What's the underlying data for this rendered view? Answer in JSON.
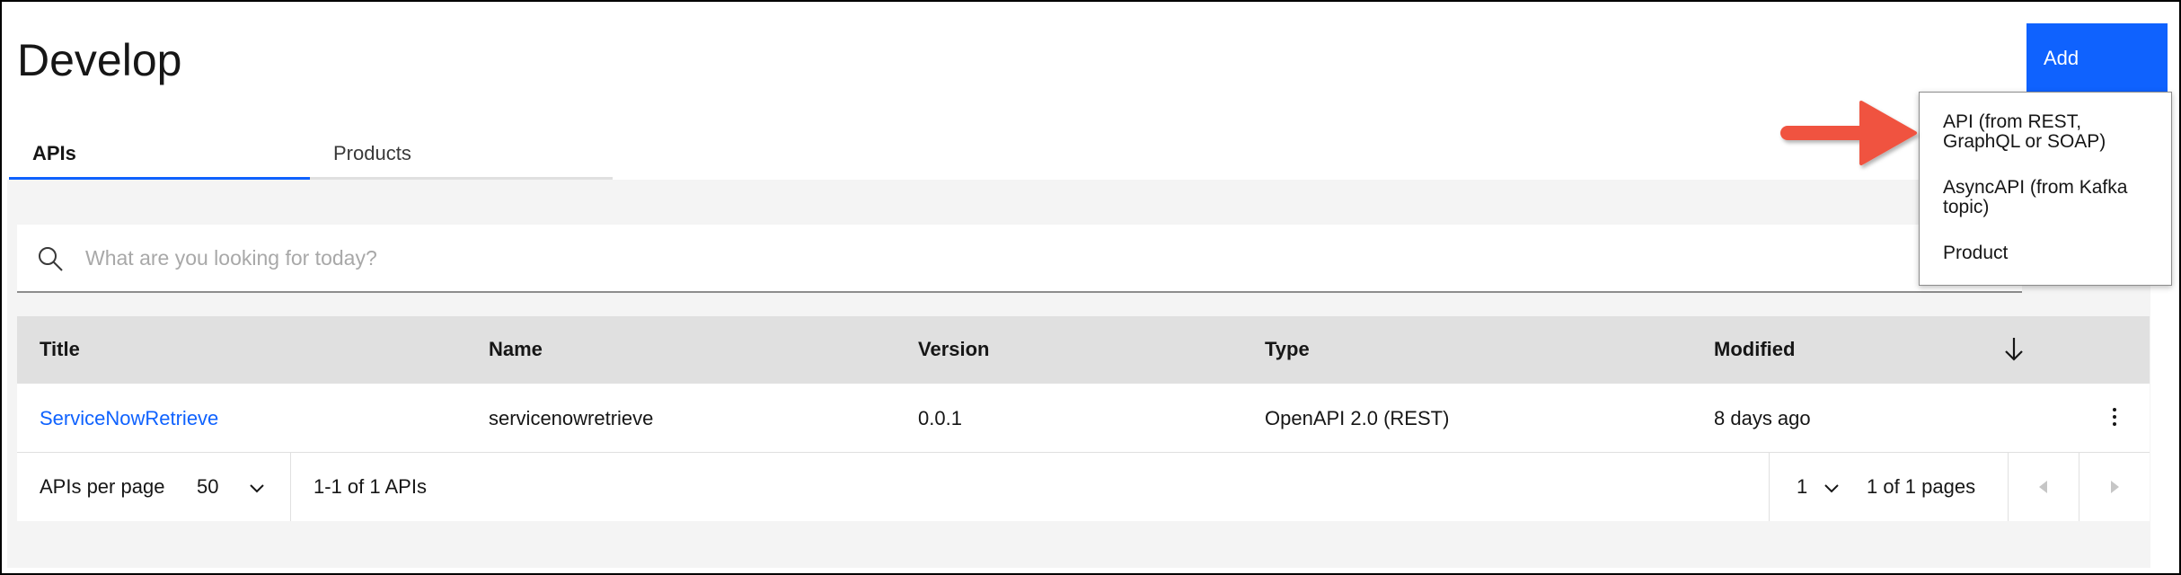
{
  "page": {
    "title": "Develop"
  },
  "add_button": {
    "label": "Add"
  },
  "tabs": [
    {
      "label": "APIs",
      "selected": true
    },
    {
      "label": "Products",
      "selected": false
    }
  ],
  "search": {
    "placeholder": "What are you looking for today?"
  },
  "table": {
    "columns": [
      "Title",
      "Name",
      "Version",
      "Type",
      "Modified"
    ],
    "rows": [
      {
        "title": "ServiceNowRetrieve",
        "name": "servicenowretrieve",
        "version": "0.0.1",
        "type": "OpenAPI 2.0 (REST)",
        "modified": "8 days ago"
      }
    ]
  },
  "pagination": {
    "per_page_label": "APIs per page",
    "per_page_value": "50",
    "range_text": "1-1 of 1 APIs",
    "page_value": "1",
    "pages_text": "1 of 1 pages"
  },
  "dropdown_menu": {
    "items": [
      {
        "line1": "API (from REST,",
        "line2": "GraphQL or SOAP)"
      },
      {
        "line1": "AsyncAPI (from Kafka",
        "line2": "topic)"
      },
      {
        "line1": "Product",
        "line2": ""
      }
    ]
  },
  "colors": {
    "primary": "#0f62fe",
    "annotation_arrow": "#f0533f"
  },
  "icons": [
    "search-icon",
    "sort-arrow-down-icon",
    "overflow-menu-icon",
    "chevron-down-icon",
    "caret-left-icon",
    "caret-right-icon"
  ]
}
